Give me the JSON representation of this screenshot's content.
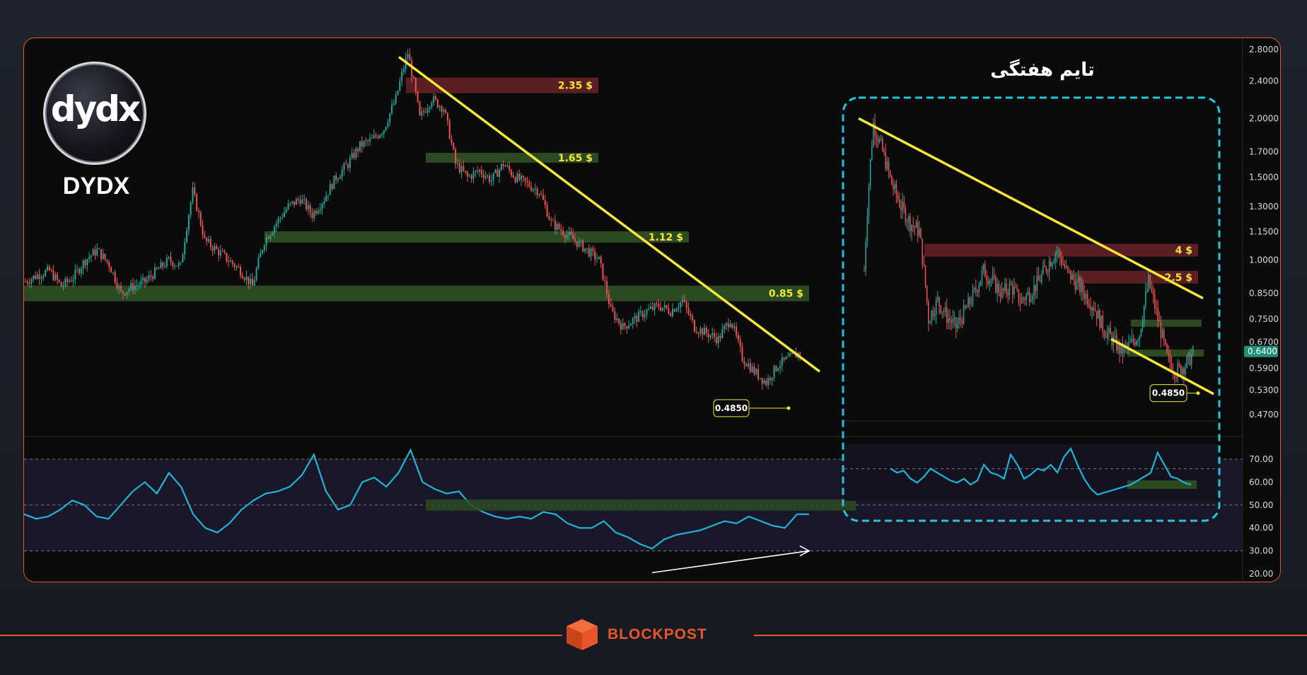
{
  "branding": {
    "logo_text": "dydx",
    "ticker": "DYDX",
    "footer_brand": "BLOCKPOST"
  },
  "weekly_panel": {
    "title": "تایم هفتگی"
  },
  "colors": {
    "accent": "#e8562a",
    "up_candle": "#26a69a",
    "down_candle": "#ef5350",
    "trendline": "#f5e63a",
    "rsi_line": "#1fb4d8",
    "support_zone": "#2b4a22",
    "resistance_zone": "#5b1e22",
    "weekly_box": "#27c3dc"
  },
  "chart_data": {
    "type": "candlestick",
    "price_axis": {
      "scale": "log",
      "ticks": [
        "2.8000",
        "2.4000",
        "2.0000",
        "1.7000",
        "1.5000",
        "1.3000",
        "1.1500",
        "1.0000",
        "0.8500",
        "0.7500",
        "0.6700",
        "0.5900",
        "0.5300",
        "0.4700"
      ],
      "current_price": "0.6400"
    },
    "rsi_axis": {
      "ticks": [
        "70.00",
        "60.00",
        "50.00",
        "40.00",
        "30.00",
        "20.00"
      ],
      "ylim": [
        20,
        75
      ],
      "guide_levels": [
        70,
        50,
        30
      ]
    },
    "daily": {
      "price_range": [
        0.48,
        2.75
      ],
      "levels": [
        {
          "label": "2.35 $",
          "value": 2.35,
          "kind": "resistance"
        },
        {
          "label": "1.65 $",
          "value": 1.65,
          "kind": "support"
        },
        {
          "label": "1.12 $",
          "value": 1.12,
          "kind": "support"
        },
        {
          "label": "0.85 $",
          "value": 0.85,
          "kind": "support"
        }
      ],
      "trendline": {
        "from": 2.7,
        "to": 0.58
      },
      "low_marker": {
        "label": "0.4850",
        "value": 0.485
      },
      "close_path": [
        0.9,
        0.93,
        0.95,
        0.88,
        0.92,
        1.0,
        1.05,
        0.98,
        0.85,
        0.88,
        0.9,
        0.95,
        1.0,
        0.97,
        1.4,
        1.1,
        1.05,
        1.0,
        0.95,
        0.88,
        1.1,
        1.2,
        1.3,
        1.35,
        1.25,
        1.35,
        1.5,
        1.6,
        1.75,
        1.8,
        1.9,
        2.2,
        2.75,
        2.0,
        2.2,
        2.1,
        1.6,
        1.5,
        1.55,
        1.48,
        1.6,
        1.5,
        1.45,
        1.4,
        1.2,
        1.15,
        1.1,
        1.05,
        1.0,
        0.78,
        0.72,
        0.75,
        0.78,
        0.8,
        0.78,
        0.82,
        0.72,
        0.7,
        0.68,
        0.75,
        0.62,
        0.58,
        0.55,
        0.6,
        0.62,
        0.64
      ],
      "rsi": [
        46,
        44,
        45,
        48,
        52,
        50,
        45,
        44,
        50,
        56,
        60,
        55,
        64,
        58,
        46,
        40,
        38,
        42,
        48,
        52,
        55,
        56,
        58,
        63,
        72,
        56,
        48,
        50,
        60,
        62,
        58,
        64,
        74,
        60,
        57,
        55,
        56,
        50,
        47,
        45,
        44,
        45,
        44,
        47,
        46,
        42,
        40,
        40,
        43,
        38,
        36,
        33,
        31,
        35,
        37,
        38,
        39,
        41,
        43,
        42,
        45,
        43,
        41,
        40,
        46,
        46
      ]
    },
    "weekly": {
      "levels": [
        {
          "label": "4 $",
          "value": 4,
          "kind": "resistance"
        },
        {
          "label": "2.5 $",
          "value": 2.5,
          "kind": "resistance"
        }
      ],
      "trendline_upper": {
        "from": 2.0,
        "to": 0.83
      },
      "trendline_lower": {
        "from": 0.68,
        "to": 0.52
      },
      "low_marker": {
        "label": "0.4850",
        "value": 0.485
      },
      "close_path": [
        0.95,
        1.95,
        1.7,
        1.45,
        1.3,
        1.2,
        1.15,
        0.75,
        0.82,
        0.76,
        0.72,
        0.78,
        0.85,
        0.95,
        0.9,
        0.85,
        0.88,
        0.82,
        0.85,
        0.9,
        0.98,
        1.05,
        0.95,
        0.9,
        0.85,
        0.8,
        0.72,
        0.68,
        0.64,
        0.66,
        0.7,
        0.9,
        0.75,
        0.62,
        0.58,
        0.6,
        0.64
      ],
      "rsi": [
        60,
        58,
        59,
        55,
        53,
        56,
        60,
        58,
        56,
        54,
        53,
        55,
        52,
        54,
        62,
        58,
        57,
        55,
        67,
        62,
        55,
        57,
        60,
        59,
        62,
        58,
        66,
        70,
        62,
        55,
        50,
        47,
        48,
        49,
        50,
        51,
        52,
        54,
        56,
        58,
        68,
        62,
        56,
        55,
        53,
        52
      ]
    },
    "annotations": [
      "rsi bullish divergence arrow"
    ]
  }
}
